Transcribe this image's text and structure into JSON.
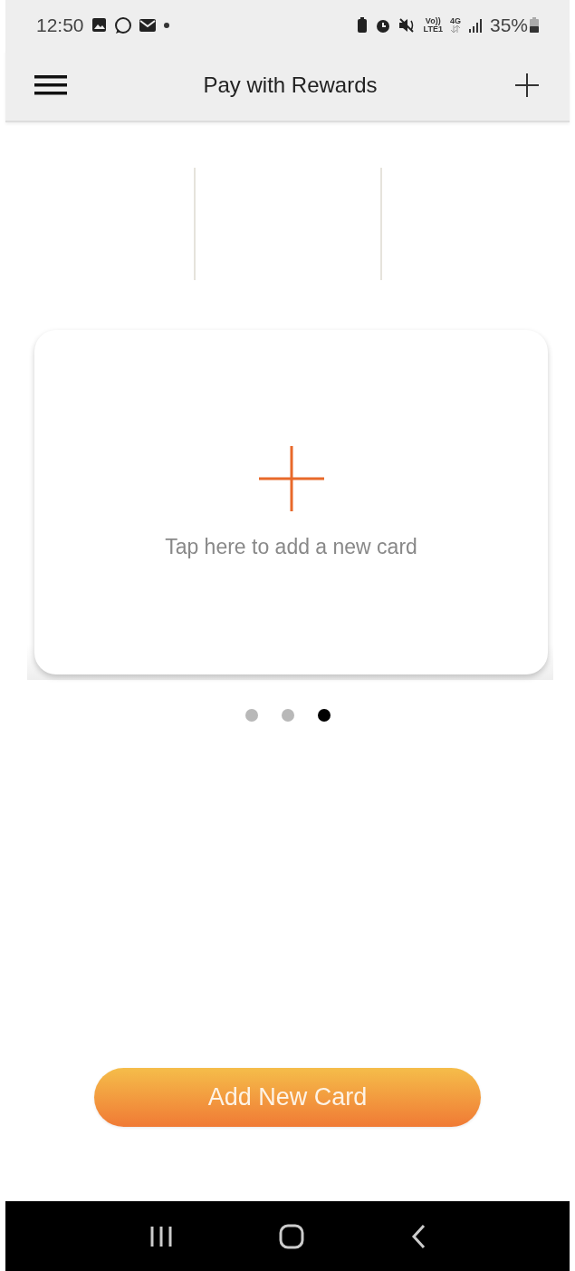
{
  "status_bar": {
    "time": "12:50",
    "volte_top": "Vo))",
    "volte_bottom": "LTE1",
    "network": "4G",
    "battery": "35%"
  },
  "app_bar": {
    "title": "Pay with Rewards"
  },
  "carousel": {
    "card": {
      "prompt": "Tap here to add a new card"
    },
    "pages": [
      {
        "selected": false
      },
      {
        "selected": false
      },
      {
        "selected": true
      }
    ]
  },
  "primary_button": {
    "label": "Add New Card"
  }
}
